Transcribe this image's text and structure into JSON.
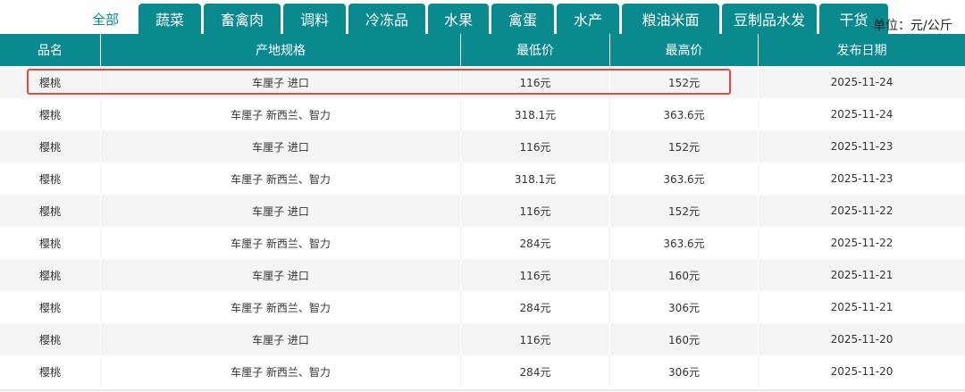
{
  "tabs": {
    "all_label": "全部",
    "categories": [
      "蔬菜",
      "畜禽肉",
      "调料",
      "冷冻品",
      "水果",
      "禽蛋",
      "水产",
      "粮油米面",
      "豆制品水发",
      "干货"
    ]
  },
  "unit_label": "单位：元/公斤",
  "table": {
    "headers": [
      "品名",
      "产地规格",
      "最低价",
      "最高价",
      "发布日期"
    ],
    "rows": [
      [
        "樱桃",
        "车厘子 进口",
        "116元",
        "152元",
        "2025-11-24"
      ],
      [
        "樱桃",
        "车厘子 新西兰、智力",
        "318.1元",
        "363.6元",
        "2025-11-24"
      ],
      [
        "樱桃",
        "车厘子 进口",
        "116元",
        "152元",
        "2025-11-23"
      ],
      [
        "樱桃",
        "车厘子 新西兰、智力",
        "318.1元",
        "363.6元",
        "2025-11-23"
      ],
      [
        "樱桃",
        "车厘子 进口",
        "116元",
        "152元",
        "2025-11-22"
      ],
      [
        "樱桃",
        "车厘子 新西兰、智力",
        "284元",
        "363.6元",
        "2025-11-22"
      ],
      [
        "樱桃",
        "车厘子 进口",
        "116元",
        "160元",
        "2025-11-21"
      ],
      [
        "樱桃",
        "车厘子 新西兰、智力",
        "284元",
        "306元",
        "2025-11-21"
      ],
      [
        "樱桃",
        "车厘子 进口",
        "116元",
        "160元",
        "2025-11-20"
      ],
      [
        "樱桃",
        "车厘子 新西兰、智力",
        "284元",
        "306元",
        "2025-11-20"
      ]
    ]
  },
  "colors": {
    "accent": "#0a8a8f",
    "highlight_border": "#e24a3b",
    "stripe": "#f4f4f4"
  }
}
